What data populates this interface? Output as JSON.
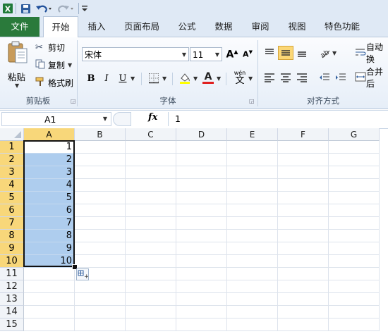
{
  "qat": {
    "app_icon": "excel-icon",
    "save_icon": "save-icon",
    "undo_icon": "undo-icon",
    "redo_icon": "redo-icon",
    "customize_icon": "customize-qat-icon"
  },
  "tabs": [
    {
      "label": "文件"
    },
    {
      "label": "开始"
    },
    {
      "label": "插入"
    },
    {
      "label": "页面布局"
    },
    {
      "label": "公式"
    },
    {
      "label": "数据"
    },
    {
      "label": "审阅"
    },
    {
      "label": "视图"
    },
    {
      "label": "特色功能"
    }
  ],
  "clipboard": {
    "paste_label": "粘贴",
    "cut_label": "剪切",
    "copy_label": "复制",
    "format_painter_label": "格式刷",
    "group_label": "剪贴板"
  },
  "font": {
    "font_name": "宋体",
    "font_size": "11",
    "bold": "B",
    "italic": "I",
    "underline": "U",
    "font_color_glyph": "A",
    "phonetic_glyph": "wén",
    "phonetic_char": "文",
    "group_label": "字体"
  },
  "alignment": {
    "wrap_label": "自动换",
    "merge_label": "合并后",
    "group_label": "对齐方式"
  },
  "formula_bar": {
    "name_box": "A1",
    "fx": "fx",
    "value": "1"
  },
  "sheet": {
    "columns": [
      "A",
      "B",
      "C",
      "D",
      "E",
      "F",
      "G"
    ],
    "rows": [
      "1",
      "2",
      "3",
      "4",
      "5",
      "6",
      "7",
      "8",
      "9",
      "10",
      "11",
      "12",
      "13",
      "14",
      "15"
    ],
    "col_a_values": [
      "1",
      "2",
      "3",
      "4",
      "5",
      "6",
      "7",
      "8",
      "9",
      "10"
    ],
    "selected_range": "A1:A10"
  },
  "colors": {
    "file_tab": "#2a7a3b",
    "selection_fill": "#aecdee",
    "header_highlight": "#f8d77a",
    "font_color_bar": "#e02020",
    "fill_color_bar": "#ffff00"
  }
}
